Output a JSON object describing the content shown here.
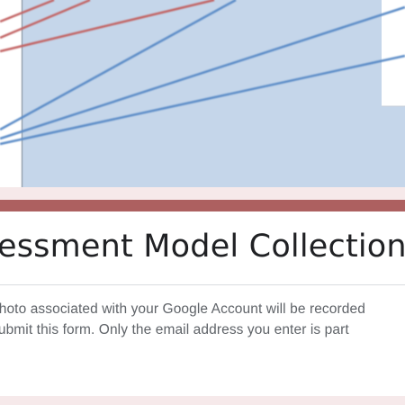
{
  "header_image": {
    "description_icon": "line-graph-banner",
    "panel_color": "#c5d6ea",
    "red_line_color": "#c26363",
    "blue_line_color": "#5b8cc7"
  },
  "form": {
    "title": "Assessment Model Collection",
    "notice_line_1": "photo associated with your Google Account will be recorded",
    "notice_line_2": "submit this form. Only the email address you enter is part"
  },
  "colors": {
    "page_background": "#f6e9ea",
    "accent": "#ad6060",
    "title_text": "#202124",
    "notice_text": "#5f6368"
  }
}
